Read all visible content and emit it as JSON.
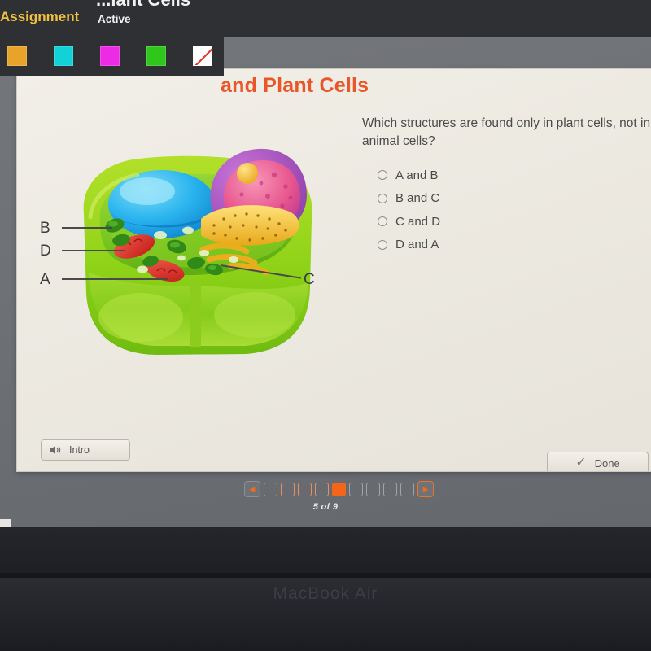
{
  "overlay": {
    "window_title": "...lant Cells",
    "assignment_label": "Assignment",
    "status_label": "Active",
    "swatches": [
      {
        "name": "orange-swatch",
        "color": "#E8A32A"
      },
      {
        "name": "cyan-swatch",
        "color": "#12D2D8"
      },
      {
        "name": "magenta-swatch",
        "color": "#EE2BE4"
      },
      {
        "name": "green-swatch",
        "color": "#2FC71C"
      },
      {
        "name": "no-color-swatch",
        "color": "#FFFFFF"
      }
    ]
  },
  "lesson": {
    "title": "and Plant Cells",
    "title_color": "#E8572A"
  },
  "question": {
    "text": "Which structures are found only in plant cells, not in animal cells?",
    "choices": [
      {
        "id": "a",
        "label": "A and B",
        "selected": false
      },
      {
        "id": "b",
        "label": "B and C",
        "selected": false
      },
      {
        "id": "c",
        "label": "C and D",
        "selected": false
      },
      {
        "id": "d",
        "label": "D and A",
        "selected": false
      }
    ]
  },
  "figure": {
    "caption": "plant-cell-diagram",
    "labels": [
      {
        "key": "B",
        "text": "B"
      },
      {
        "key": "D",
        "text": "D"
      },
      {
        "key": "A",
        "text": "A"
      },
      {
        "key": "C",
        "text": "C"
      }
    ]
  },
  "controls": {
    "intro_label": "Intro",
    "intro_icon": "speaker-icon",
    "done_label": "Done",
    "done_icon": "check-icon"
  },
  "pager": {
    "prev_icon": "triangle-left-icon",
    "next_icon": "triangle-right-icon",
    "total": 9,
    "current": 5,
    "count_text": "5 of 9",
    "current_color": "#F4651A"
  },
  "device": {
    "brand_text": "MacBook Air"
  }
}
